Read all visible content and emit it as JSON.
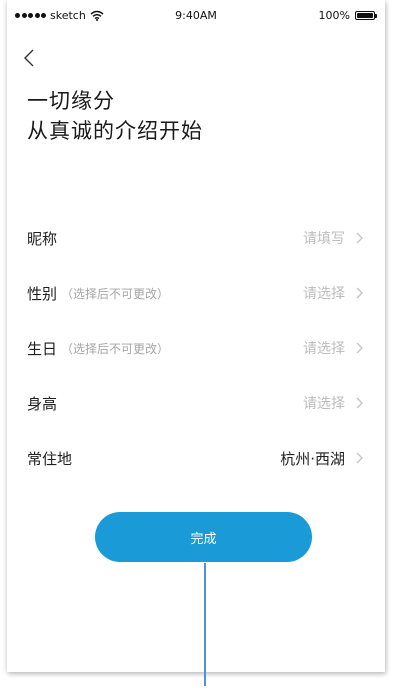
{
  "status_bar": {
    "carrier": "sketch",
    "time": "9:40AM",
    "battery": "100%"
  },
  "headline": {
    "line1": "一切缘分",
    "line2": "从真诚的介绍开始"
  },
  "form": {
    "nickname": {
      "label": "昵称",
      "hint": "",
      "value": "请填写"
    },
    "gender": {
      "label": "性别",
      "hint": "（选择后不可更改）",
      "value": "请选择"
    },
    "birthday": {
      "label": "生日",
      "hint": "（选择后不可更改）",
      "value": "请选择"
    },
    "height": {
      "label": "身高",
      "hint": "",
      "value": "请选择"
    },
    "residence": {
      "label": "常住地",
      "hint": "",
      "value": "杭州·西湖"
    }
  },
  "done_button": {
    "label": "完成"
  },
  "colors": {
    "accent": "#1a9ad6",
    "placeholder": "#bdbdbd",
    "pointer": "#4f8fe8"
  }
}
